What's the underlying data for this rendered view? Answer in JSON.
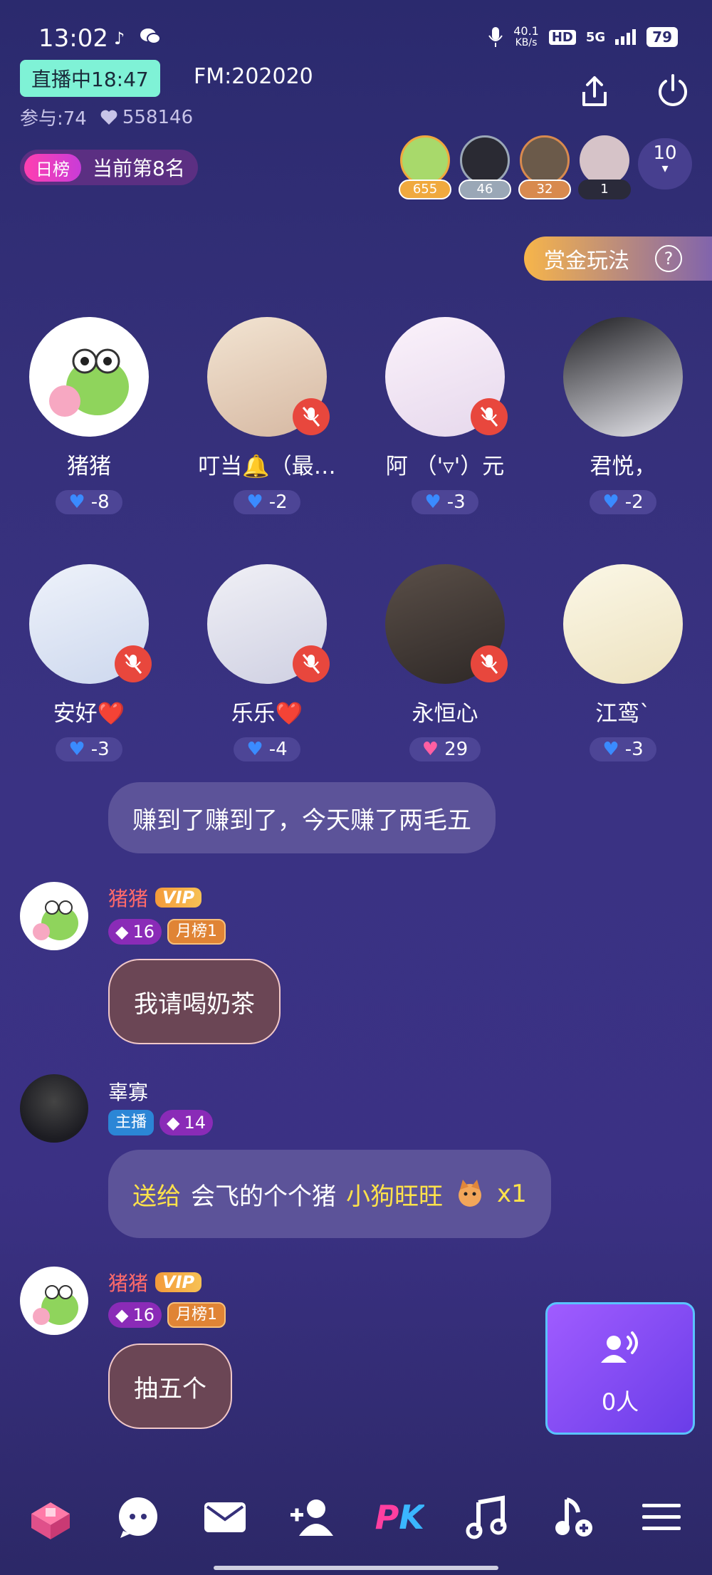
{
  "status": {
    "time": "13:02",
    "net_speed": "40.1",
    "net_unit": "KB/s",
    "hd": "HD",
    "signal": "5G",
    "battery": "79"
  },
  "header": {
    "live_label": "直播中18:47",
    "fm": "FM:202020",
    "participants": "参与:74",
    "likes": "558146",
    "rank_tag": "日榜",
    "rank_text": "当前第8名",
    "bounty": "赏金玩法",
    "help": "?",
    "more_count": "10"
  },
  "top_users": [
    {
      "score": "655",
      "color": "#f0a93e",
      "avatar_color": "#a8d96b"
    },
    {
      "score": "46",
      "color": "#9aa7b6",
      "avatar_color": "#2a2a33"
    },
    {
      "score": "32",
      "color": "#d88a4e",
      "avatar_color": "#6b5a4a"
    },
    {
      "score": "1",
      "color": "#2a2a3a",
      "avatar_color": "#d6c3c8"
    }
  ],
  "seats": [
    {
      "name": "猪猪",
      "points": "-8",
      "heart_color": "#3a8bff",
      "avatar_color": "#ffffff",
      "muted": false
    },
    {
      "name": "叮当🔔（最…",
      "points": "-2",
      "heart_color": "#3a8bff",
      "avatar_color": "#e8d6c6",
      "muted": true
    },
    {
      "name": "阿 （'▿'）元",
      "points": "-3",
      "heart_color": "#3a8bff",
      "avatar_color": "#f2eaf5",
      "muted": true
    },
    {
      "name": "君悦，",
      "points": "-2",
      "heart_color": "#3a8bff",
      "avatar_color": "#d8d8de",
      "muted": false
    },
    {
      "name": "安好❤️",
      "points": "-3",
      "heart_color": "#3a8bff",
      "avatar_color": "#dfe6f2",
      "muted": true
    },
    {
      "name": "乐乐❤️",
      "points": "-4",
      "heart_color": "#3a8bff",
      "avatar_color": "#e4e4ef",
      "muted": true
    },
    {
      "name": "永恒心",
      "points": "29",
      "heart_color": "#ff5fa2",
      "avatar_color": "#4a4040",
      "muted": true
    },
    {
      "name": "江鸾`",
      "points": "-3",
      "heart_color": "#3a8bff",
      "avatar_color": "#f6f1df",
      "muted": false
    }
  ],
  "chat": {
    "msg0": "赚到了赚到了，今天赚了两毛五",
    "m1": {
      "name": "猪猪",
      "vip": "VIP",
      "level": "16",
      "month": "月榜1",
      "text": "我请喝奶茶"
    },
    "m2": {
      "name": "辜寡",
      "host": "主播",
      "level": "14",
      "gift_prefix": "送给",
      "gift_target": "会飞的个个猪",
      "gift_name": "小狗旺旺",
      "gift_count": "x1"
    },
    "m3": {
      "name": "猪猪",
      "vip": "VIP",
      "level": "16",
      "month": "月榜1",
      "text": "抽五个"
    }
  },
  "mic_queue": {
    "count": "0人"
  },
  "bottom_bar": [
    "store-icon",
    "chat-icon",
    "mail-icon",
    "add-user-icon",
    "PK",
    "music-icon",
    "add-music-icon",
    "menu-icon"
  ]
}
